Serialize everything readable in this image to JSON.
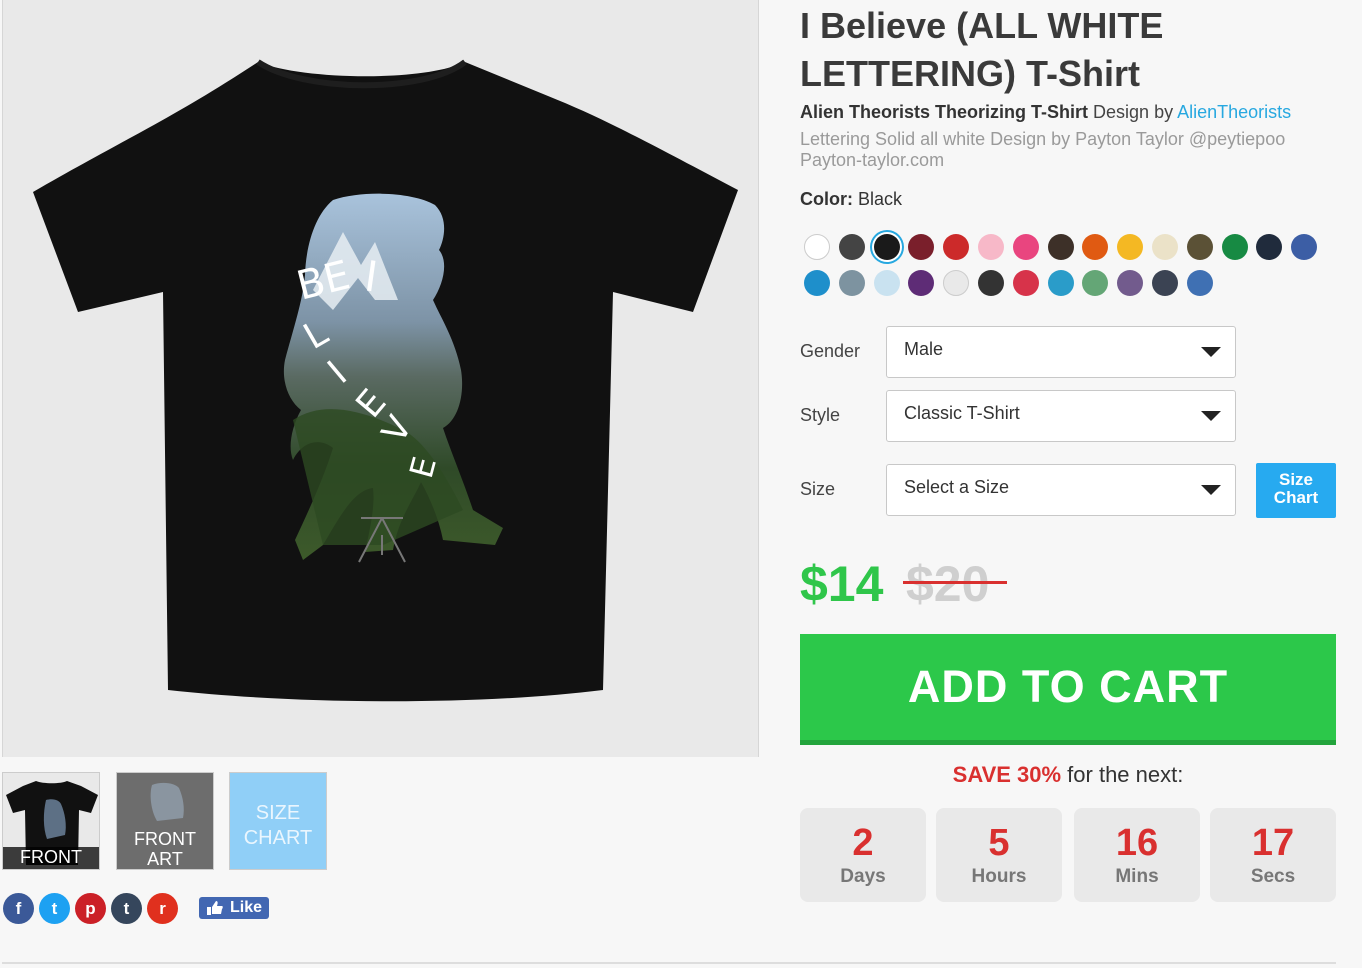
{
  "product": {
    "title": "I Believe (ALL WHITE LETTERING) T-Shirt",
    "shirt_color": "#111111",
    "artwork_text": "BELIEVE"
  },
  "design": {
    "name": "Alien Theorists Theorizing T-Shirt",
    "by_text": " Design by ",
    "artist": "AlienTheorists",
    "description": "Lettering Solid all white Design by Payton Taylor @peytiepoo Payton-taylor.com"
  },
  "thumbnails": [
    {
      "label": "FRONT"
    },
    {
      "label": "FRONT ART"
    },
    {
      "label": "SIZE CHART"
    }
  ],
  "social": {
    "icons": [
      {
        "name": "facebook",
        "glyph": "f",
        "color": "#3b5998"
      },
      {
        "name": "twitter",
        "glyph": "t",
        "color": "#1da1f2"
      },
      {
        "name": "pinterest",
        "glyph": "p",
        "color": "#cb2027"
      },
      {
        "name": "tumblr",
        "glyph": "t",
        "color": "#35465c"
      },
      {
        "name": "reddit",
        "glyph": "r",
        "color": "#e0301e"
      }
    ],
    "like_label": "Like"
  },
  "color": {
    "label": "Color:",
    "selected": "Black",
    "swatches": [
      "#ffffff",
      "#444444",
      "#1a1a1a",
      "#7a1f2b",
      "#cc2a2a",
      "#f7b8c8",
      "#e9457f",
      "#3d3028",
      "#e05a12",
      "#f4b823",
      "#ebe2c8",
      "#5b5136",
      "#178a43",
      "#202b3c",
      "#3c5ea5",
      "#1e8fcb",
      "#7d93a0",
      "#c9e2f0",
      "#5e2c76",
      "#e9e9e9",
      "#333333",
      "#d7334a",
      "#2a9cc9",
      "#64a676",
      "#725b8d",
      "#3b4353",
      "#3f70b3"
    ]
  },
  "form": {
    "gender_label": "Gender",
    "gender_value": "Male",
    "style_label": "Style",
    "style_value": "Classic T-Shirt",
    "size_label": "Size",
    "size_value": "Select a Size",
    "size_chart_label": "Size Chart"
  },
  "price": {
    "current": "$14",
    "original": "$20"
  },
  "cart": {
    "button_label": "ADD TO CART"
  },
  "sale": {
    "highlight": "SAVE 30%",
    "suffix": " for the next:"
  },
  "countdown": [
    {
      "value": "2",
      "unit": "Days"
    },
    {
      "value": "5",
      "unit": "Hours"
    },
    {
      "value": "16",
      "unit": "Mins"
    },
    {
      "value": "17",
      "unit": "Secs"
    }
  ],
  "colors": {
    "price_green": "#2fc64a",
    "cart_green": "#2cc84a",
    "accent_blue": "#27a8e0",
    "sale_red": "#d9302f"
  }
}
